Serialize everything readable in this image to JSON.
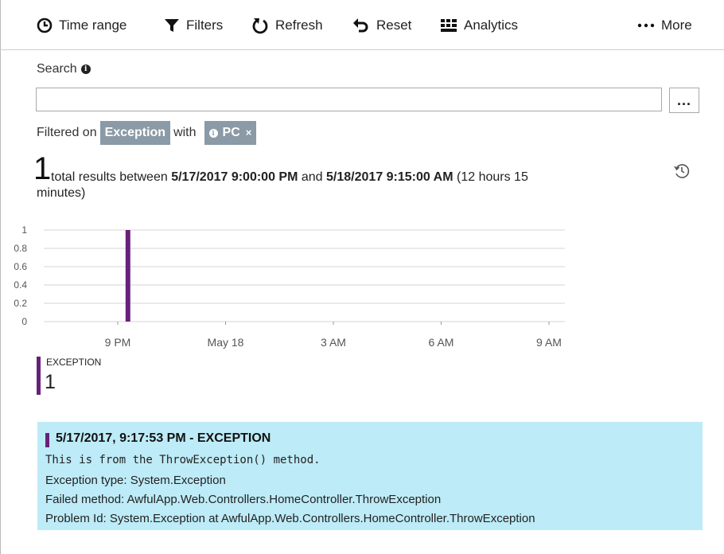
{
  "toolbar": {
    "time_range": "Time range",
    "filters": "Filters",
    "refresh": "Refresh",
    "reset": "Reset",
    "analytics": "Analytics",
    "more": "More"
  },
  "search": {
    "label": "Search",
    "value": "",
    "more_button": "..."
  },
  "filter": {
    "prefix": "Filtered on",
    "type_chip": "Exception",
    "with_text": "with",
    "chip": "PC",
    "chip_close": "×"
  },
  "summary": {
    "count": "1",
    "text_pre": "total results between",
    "start": "5/17/2017 9:00:00 PM",
    "and_text": "and",
    "end": "5/18/2017 9:15:00 AM",
    "duration_part1": "(12 hours 15",
    "duration_part2": "minutes)"
  },
  "chart_data": {
    "type": "bar",
    "x_ticks": [
      "9 PM",
      "May 18",
      "3 AM",
      "6 AM",
      "9 AM"
    ],
    "y_ticks": [
      "1",
      "0.8",
      "0.6",
      "0.4",
      "0.2",
      "0"
    ],
    "ylim": [
      0,
      1
    ],
    "series": [
      {
        "name": "EXCEPTION",
        "color": "#68217a",
        "points": [
          {
            "x": "5/17/2017 9:17 PM",
            "value": 1
          }
        ]
      }
    ]
  },
  "legend": {
    "label": "EXCEPTION",
    "value": "1",
    "color": "#68217a"
  },
  "result": {
    "title": "5/17/2017, 9:17:53 PM - EXCEPTION",
    "message": "This is from the ThrowException() method.",
    "exception_type": "Exception type: System.Exception",
    "failed_method": "Failed method: AwfulApp.Web.Controllers.HomeController.ThrowException",
    "problem_id": "Problem Id: System.Exception at AwfulApp.Web.Controllers.HomeController.ThrowException",
    "background": "#bdebf7"
  }
}
